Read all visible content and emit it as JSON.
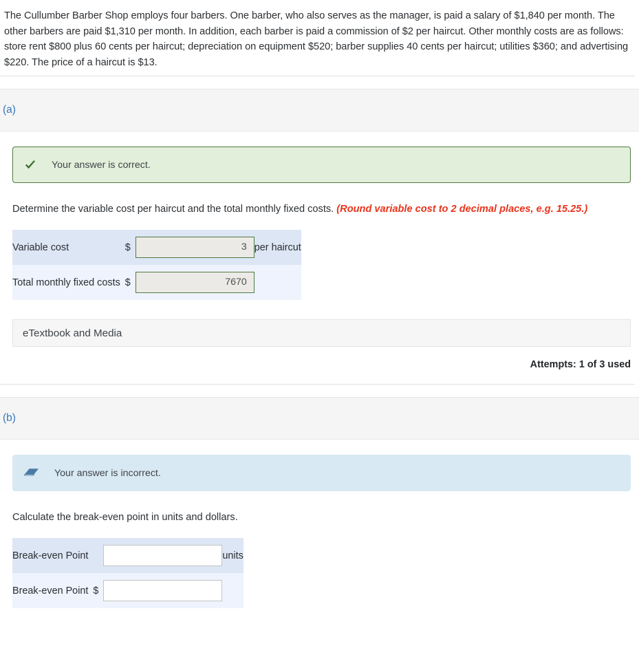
{
  "problem": {
    "statement": "The Cullumber Barber Shop employs four barbers. One barber, who also serves as the manager, is paid a salary of $1,840 per month. The other barbers are paid $1,310 per month. In addition, each barber is paid a commission of $2 per haircut. Other monthly costs are as follows: store rent $800 plus 60 cents per haircut; depreciation on equipment $520; barber supplies 40 cents per haircut; utilities $360; and advertising $220. The price of a haircut is $13."
  },
  "parts": [
    {
      "label": "(a)",
      "status": {
        "text": "Your answer is correct.",
        "icon": "check-icon",
        "kind": "correct",
        "bg_color": "#e2efda",
        "border_color": "#4f7a43"
      },
      "prompt_text": "Determine the variable cost per haircut and the total monthly fixed costs. ",
      "prompt_hint": "(Round variable cost to 2 decimal places, e.g. 15.25.)",
      "hint_color": "#e8341c",
      "rows": [
        {
          "label": "Variable cost",
          "dollar": "$",
          "value": "3",
          "placeholder": "",
          "suffix": "per haircut",
          "state": "graded"
        },
        {
          "label": "Total monthly fixed costs",
          "dollar": "$",
          "value": "7670",
          "placeholder": "",
          "suffix": "",
          "state": "graded"
        }
      ],
      "etextbook_label": "eTextbook and Media",
      "attempts_text": "Attempts: 1 of 3 used"
    },
    {
      "label": "(b)",
      "status": {
        "text": "Your answer is incorrect.",
        "icon": "eraser-icon",
        "kind": "incorrect",
        "bg_color": "#d9e9f3",
        "border_color": "#d9e9f3"
      },
      "prompt_text": "Calculate the break-even point in units and dollars.",
      "prompt_hint": "",
      "hint_color": "#e8341c",
      "rows": [
        {
          "label": "Break-even Point",
          "dollar": "",
          "value": "",
          "placeholder": "",
          "suffix": "units",
          "state": "blank"
        },
        {
          "label": "Break-even Point",
          "dollar": "$",
          "value": "",
          "placeholder": "",
          "suffix": "",
          "state": "blank"
        }
      ],
      "etextbook_label": "",
      "attempts_text": ""
    }
  ]
}
